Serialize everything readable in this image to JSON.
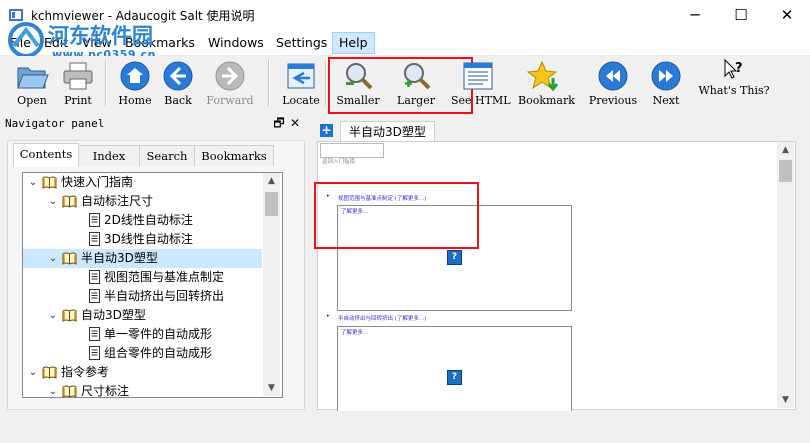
{
  "window": {
    "title": "kchmviewer - Adaucogit Salt 使用说明",
    "minimize": "─",
    "maximize": "☐",
    "close": "✕"
  },
  "watermark": {
    "line1": "河东软件园",
    "line2": "www.pc0359.cn"
  },
  "menu": [
    "File",
    "Edit",
    "View",
    "Bookmarks",
    "Windows",
    "Settings",
    "Help"
  ],
  "menu_active": "Help",
  "toolbar": {
    "open": "Open",
    "print": "Print",
    "home": "Home",
    "back": "Back",
    "forward": "Forward",
    "locate": "Locate",
    "smaller": "Smaller",
    "larger": "Larger",
    "see_html": "See HTML",
    "bookmark": "Bookmark",
    "previous": "Previous",
    "next": "Next",
    "whats_this": "What's This?"
  },
  "navigator": {
    "title": "Navigator panel",
    "float_glyph": "🗗",
    "close_glyph": "✕",
    "tabs": [
      "Contents",
      "Index",
      "Search",
      "Bookmarks"
    ],
    "selected_tab": "Contents",
    "tree": [
      {
        "label": "快速入门指南",
        "level": 0,
        "kind": "book",
        "expanded": true
      },
      {
        "label": "自动标注尺寸",
        "level": 1,
        "kind": "book",
        "expanded": true
      },
      {
        "label": "2D线性自动标注",
        "level": 2,
        "kind": "page"
      },
      {
        "label": "3D线性自动标注",
        "level": 2,
        "kind": "page"
      },
      {
        "label": "半自动3D塑型",
        "level": 1,
        "kind": "book",
        "expanded": true,
        "selected": true
      },
      {
        "label": "视图范围与基准点制定",
        "level": 2,
        "kind": "page"
      },
      {
        "label": "半自动挤出与回转挤出",
        "level": 2,
        "kind": "page"
      },
      {
        "label": "自动3D塑型",
        "level": 1,
        "kind": "book",
        "expanded": true
      },
      {
        "label": "单一零件的自动成形",
        "level": 2,
        "kind": "page"
      },
      {
        "label": "组合零件的自动成形",
        "level": 2,
        "kind": "page"
      },
      {
        "label": "指令参考",
        "level": 0,
        "kind": "book",
        "expanded": true
      },
      {
        "label": "尺寸标注",
        "level": 1,
        "kind": "book",
        "expanded": true
      }
    ]
  },
  "content": {
    "tab_plus": "+",
    "tab_label": "半自动3D塑型",
    "small_note": "返回入门指南",
    "bullet1": "视图范围与基准点制定 (了解更多...)",
    "frame1_text": "了解更多...",
    "bullet2": "半自动挤出与回转挤出 (了解更多...)",
    "frame2_text": "了解更多...",
    "help_icon": "?"
  },
  "colors": {
    "highlight_red": "#e8121b",
    "selection": "#cce8ff",
    "link": "#3333cc",
    "toolbar_blue": "#2b7bd6"
  }
}
